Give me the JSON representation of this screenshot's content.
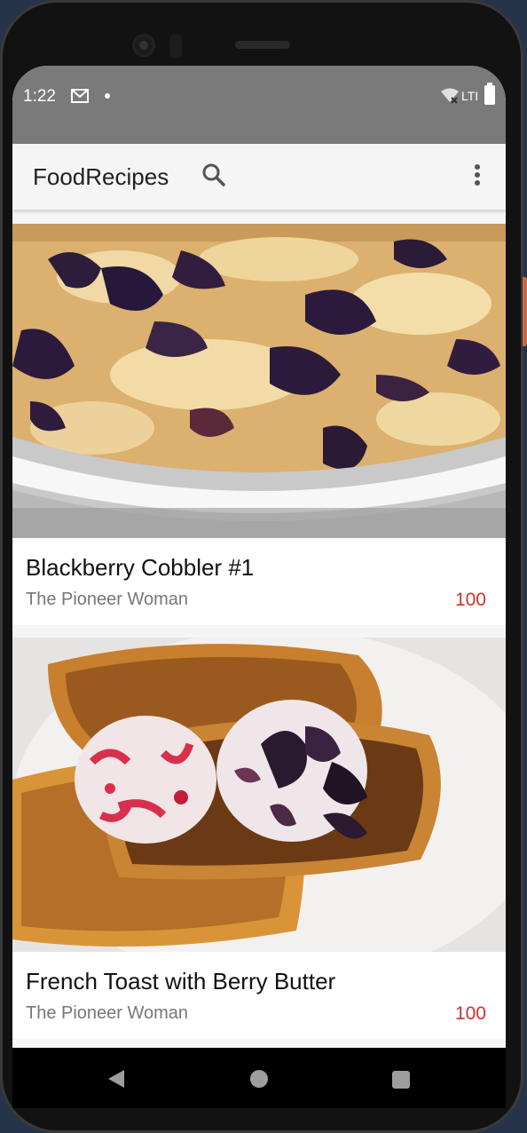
{
  "status_bar": {
    "time": "1:22",
    "network": "LTI",
    "icons": [
      "gmail-icon",
      "notification-dot-icon",
      "wifi-off-icon",
      "battery-icon"
    ]
  },
  "app_bar": {
    "title": "FoodRecipes",
    "search_icon": "search-icon",
    "menu_icon": "overflow-menu-icon"
  },
  "recipes": [
    {
      "title": "Blackberry Cobbler #1",
      "source": "The Pioneer Woman",
      "rating": "100",
      "image": "blackberry-cobbler-photo"
    },
    {
      "title": "French Toast with Berry Butter",
      "source": "The Pioneer Woman",
      "rating": "100",
      "image": "french-toast-photo"
    }
  ],
  "nav_bar": {
    "icons": [
      "back-icon",
      "home-icon",
      "recents-icon"
    ]
  },
  "colors": {
    "status_bar": "#7a7a7a",
    "app_bar": "#f5f5f5",
    "rating": "#d32f2f",
    "source_text": "#777777"
  }
}
